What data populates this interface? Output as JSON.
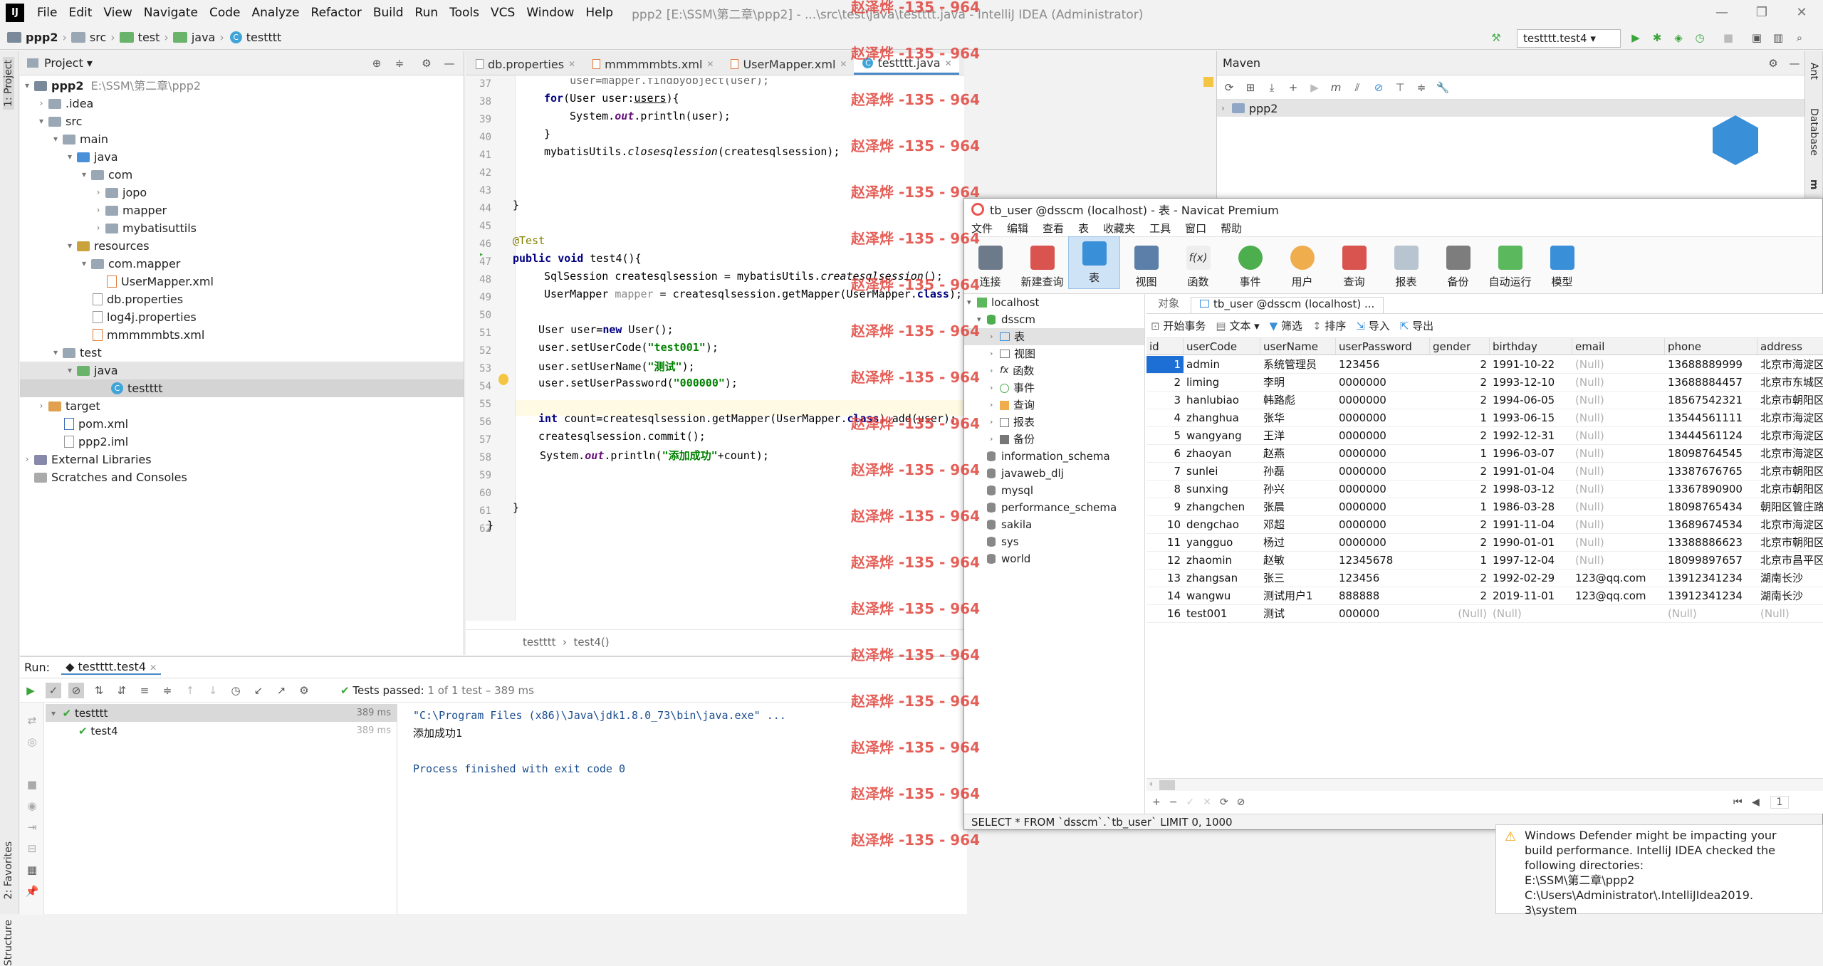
{
  "menubar": {
    "items": [
      "File",
      "Edit",
      "View",
      "Navigate",
      "Code",
      "Analyze",
      "Refactor",
      "Build",
      "Run",
      "Tools",
      "VCS",
      "Window",
      "Help"
    ],
    "window_title": "ppp2 [E:\\SSM\\第二章\\ppp2] - ...\\src\\test\\java\\testttt.java - IntelliJ IDEA (Administrator)"
  },
  "breadcrumb": [
    "ppp2",
    "src",
    "test",
    "java",
    "testttt"
  ],
  "run_config": "testttt.test4",
  "project": {
    "header": "Project",
    "strip_label": "1: Project",
    "root_path": "E:\\SSM\\第二章\\ppp2",
    "tree": [
      "ppp2",
      ".idea",
      "src",
      "main",
      "java",
      "com",
      "jopo",
      "mapper",
      "mybatisuttils",
      "resources",
      "com.mapper",
      "UserMapper.xml",
      "db.properties",
      "log4j.properties",
      "mmmmmbts.xml",
      "test",
      "java",
      "testttt",
      "target",
      "pom.xml",
      "ppp2.iml",
      "External Libraries",
      "Scratches and Consoles"
    ]
  },
  "editor": {
    "tabs": [
      "db.properties",
      "mmmmmbts.xml",
      "UserMapper.xml",
      "testttt.java"
    ],
    "line_numbers": [
      "37",
      "38",
      "39",
      "40",
      "41",
      "42",
      "43",
      "44",
      "45",
      "46",
      "47",
      "48",
      "49",
      "50",
      "51",
      "52",
      "53",
      "54",
      "55",
      "56",
      "57",
      "58",
      "59",
      "60",
      "61",
      "62"
    ],
    "breadcrumb": [
      "testttt",
      "test4()"
    ]
  },
  "maven": {
    "title": "Maven",
    "project": "ppp2",
    "strip_ant": "Ant",
    "strip_db": "Database",
    "strip_m": "m"
  },
  "run": {
    "label": "Run:",
    "tab": "testttt.test4",
    "status_bold": "Tests passed:",
    "status_rest": "1 of 1 test – 389 ms",
    "tree": [
      {
        "name": "testttt",
        "time": "389 ms"
      },
      {
        "name": "test4",
        "time": "389 ms"
      }
    ],
    "console": [
      "\"C:\\Program Files (x86)\\Java\\jdk1.8.0_73\\bin\\java.exe\" ...",
      "添加成功1",
      "",
      "Process finished with exit code 0"
    ],
    "strip_fav": "2: Favorites",
    "strip_struct": "Structure"
  },
  "watermark": "赵泽烨 -135 - 964",
  "navicat": {
    "title": "tb_user @dsscm (localhost) - 表 - Navicat Premium",
    "menu": [
      "文件",
      "编辑",
      "查看",
      "表",
      "收藏夹",
      "工具",
      "窗口",
      "帮助"
    ],
    "toolbar": [
      "连接",
      "新建查询",
      "表",
      "视图",
      "函数",
      "事件",
      "用户",
      "查询",
      "报表",
      "备份",
      "自动运行",
      "模型"
    ],
    "tree": [
      "localhost",
      "dsscm",
      "表",
      "视图",
      "函数",
      "事件",
      "查询",
      "报表",
      "备份",
      "information_schema",
      "javaweb_dlj",
      "mysql",
      "performance_schema",
      "sakila",
      "sys",
      "world"
    ],
    "obj_tab": "对象",
    "table_tab": "tb_user @dsscm (localhost) ...",
    "actions": [
      "开始事务",
      "文本",
      "筛选",
      "排序",
      "导入",
      "导出"
    ],
    "columns": [
      "id",
      "userCode",
      "userName",
      "userPassword",
      "gender",
      "birthday",
      "email",
      "phone",
      "address"
    ],
    "rows": [
      [
        "1",
        "admin",
        "系统管理员",
        "123456",
        "2",
        "1991-10-22",
        "(Null)",
        "13688889999",
        "北京市海淀区"
      ],
      [
        "2",
        "liming",
        "李明",
        "0000000",
        "2",
        "1993-12-10",
        "(Null)",
        "13688884457",
        "北京市东城区"
      ],
      [
        "3",
        "hanlubiao",
        "韩路彪",
        "0000000",
        "2",
        "1994-06-05",
        "(Null)",
        "18567542321",
        "北京市朝阳区"
      ],
      [
        "4",
        "zhanghua",
        "张华",
        "0000000",
        "1",
        "1993-06-15",
        "(Null)",
        "13544561111",
        "北京市海淀区"
      ],
      [
        "5",
        "wangyang",
        "王洋",
        "0000000",
        "2",
        "1992-12-31",
        "(Null)",
        "13444561124",
        "北京市海淀区"
      ],
      [
        "6",
        "zhaoyan",
        "赵燕",
        "0000000",
        "1",
        "1996-03-07",
        "(Null)",
        "18098764545",
        "北京市海淀区"
      ],
      [
        "7",
        "sunlei",
        "孙磊",
        "0000000",
        "2",
        "1991-01-04",
        "(Null)",
        "13387676765",
        "北京市朝阳区"
      ],
      [
        "8",
        "sunxing",
        "孙兴",
        "0000000",
        "2",
        "1998-03-12",
        "(Null)",
        "13367890900",
        "北京市朝阳区"
      ],
      [
        "9",
        "zhangchen",
        "张晨",
        "0000000",
        "1",
        "1986-03-28",
        "(Null)",
        "18098765434",
        "朝阳区管庄路"
      ],
      [
        "10",
        "dengchao",
        "邓超",
        "0000000",
        "2",
        "1991-11-04",
        "(Null)",
        "13689674534",
        "北京市海淀区"
      ],
      [
        "11",
        "yangguo",
        "杨过",
        "0000000",
        "2",
        "1990-01-01",
        "(Null)",
        "13388886623",
        "北京市朝阳区"
      ],
      [
        "12",
        "zhaomin",
        "赵敏",
        "12345678",
        "1",
        "1997-12-04",
        "(Null)",
        "18099897657",
        "北京市昌平区"
      ],
      [
        "13",
        "zhangsan",
        "张三",
        "123456",
        "2",
        "1992-02-29",
        "123@qq.com",
        "13912341234",
        "湖南长沙"
      ],
      [
        "14",
        "wangwu",
        "测试用户1",
        "888888",
        "2",
        "2019-11-01",
        "123@qq.com",
        "13912341234",
        "湖南长沙"
      ],
      [
        "16",
        "test001",
        "测试",
        "000000",
        "(Null)",
        "(Null)",
        "",
        "(Null)",
        "(Null)"
      ]
    ],
    "page": "1",
    "sql": "SELECT * FROM `dsscm`.`tb_user` LIMIT 0, 1000"
  },
  "notice": {
    "lines": [
      "Windows Defender might be impacting your",
      "build performance. IntelliJ IDEA checked the",
      "following directories:",
      "E:\\SSM\\第二章\\ppp2",
      "C:\\Users\\Administrator\\.IntelliJIdea2019.",
      "3\\system"
    ]
  }
}
